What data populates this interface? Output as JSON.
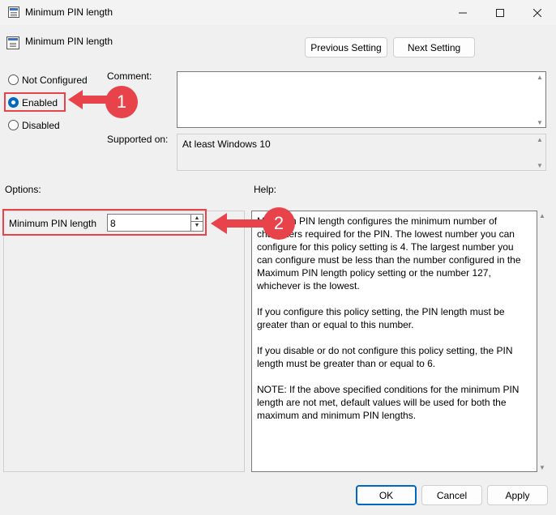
{
  "window": {
    "title": "Minimum PIN length",
    "controls": [
      "minimize-icon",
      "maximize-icon",
      "close-icon"
    ]
  },
  "header": {
    "policy_name": "Minimum PIN length",
    "previous_label": "Previous Setting",
    "next_label": "Next Setting"
  },
  "state": {
    "options": [
      "Not Configured",
      "Enabled",
      "Disabled"
    ],
    "selected": "Enabled"
  },
  "comment": {
    "label": "Comment:",
    "value": ""
  },
  "supported": {
    "label": "Supported on:",
    "value": "At least Windows 10"
  },
  "options_panel": {
    "label": "Options:",
    "field_label": "Minimum PIN length",
    "field_value": "8"
  },
  "help_panel": {
    "label": "Help:",
    "paragraphs": [
      "Minimum PIN length configures the minimum number of characters required for the PIN.  The lowest number you can configure for this policy setting is 4.  The largest number you can configure must be less than the number configured in the Maximum PIN length policy setting or the number 127, whichever is the lowest.",
      "If you configure this policy setting, the PIN length must be greater than or equal to this number.",
      "If you disable or do not configure this policy setting, the PIN length must be greater than or equal to 6.",
      "NOTE: If the above specified conditions for the minimum PIN length are not met, default values will be used for both the maximum and minimum PIN lengths."
    ]
  },
  "footer": {
    "ok_label": "OK",
    "cancel_label": "Cancel",
    "apply_label": "Apply"
  },
  "annotations": {
    "step1": "1",
    "step2": "2",
    "color": "#e8434a"
  },
  "colors": {
    "accent": "#0067c0",
    "background": "#f0f0f0"
  }
}
